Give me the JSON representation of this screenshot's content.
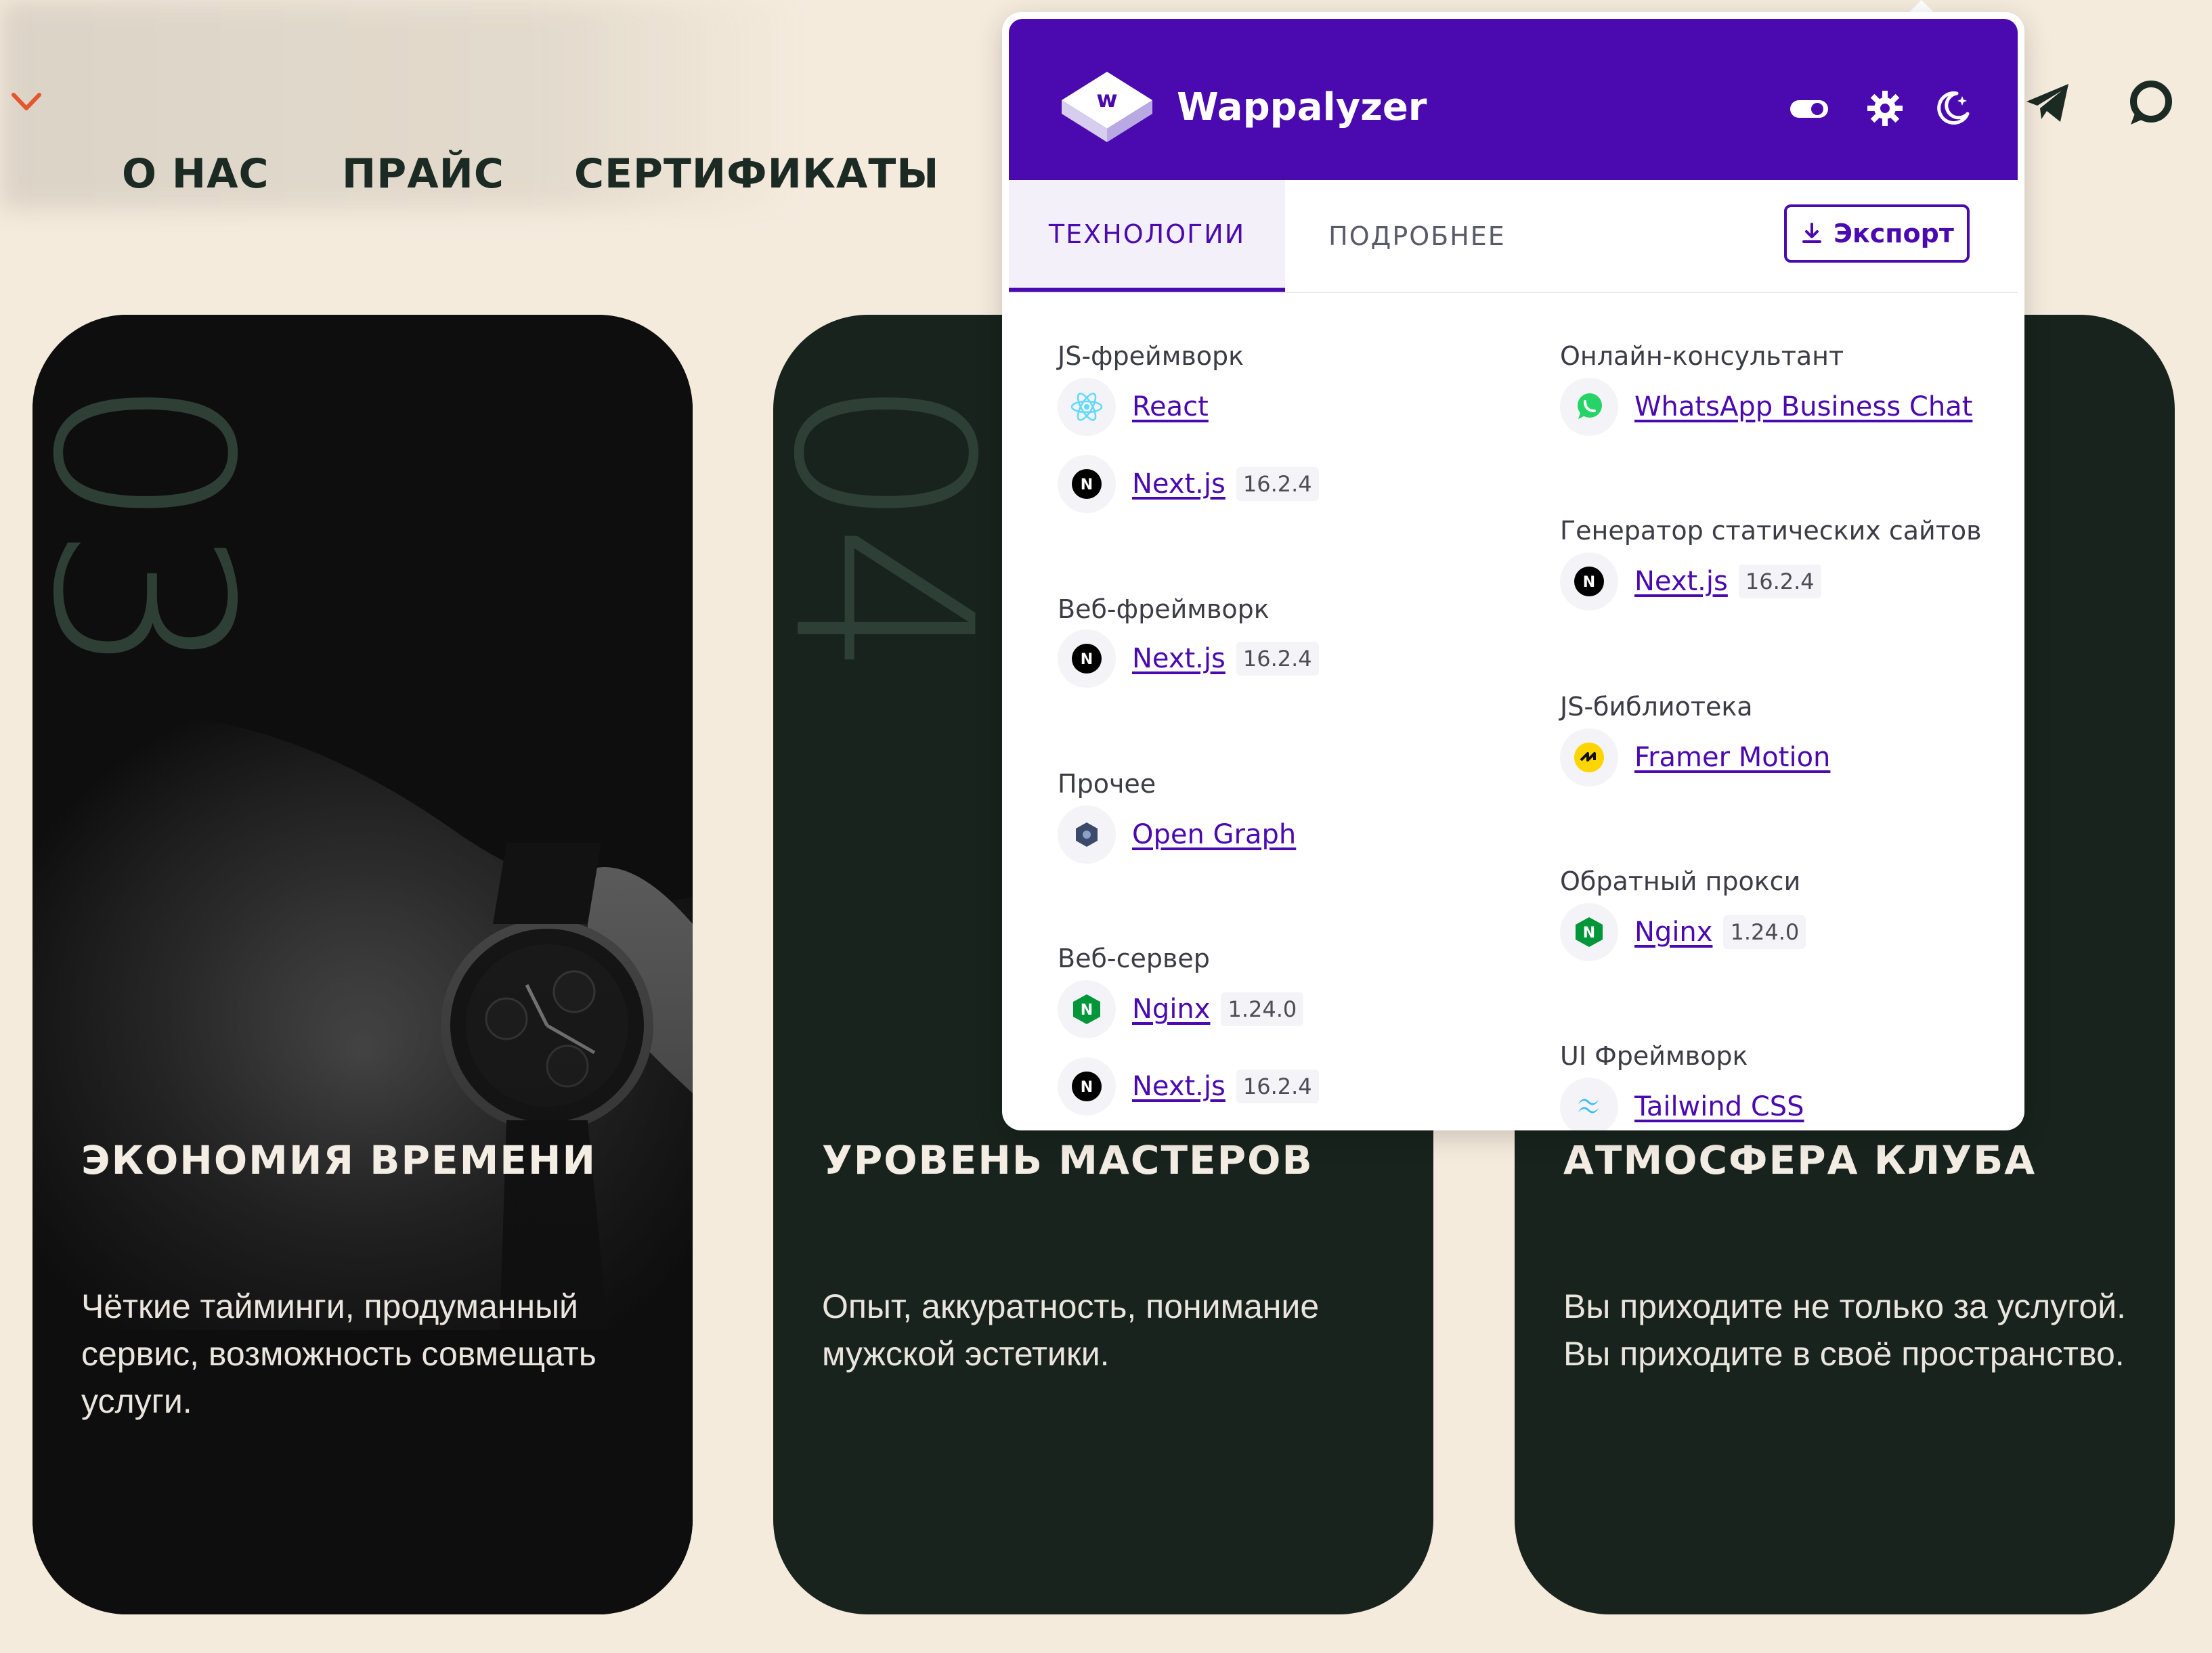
{
  "site": {
    "nav": {
      "about": "О НАС",
      "price": "ПРАЙС",
      "certificates": "СЕРТИФИКАТЫ"
    },
    "accent": "#e4572e"
  },
  "cards": [
    {
      "number": "03",
      "title": "ЭКОНОМИЯ ВРЕМЕНИ",
      "text": "Чёткие тайминги, продуманный сервис, возможность совмещать услуги."
    },
    {
      "number": "04",
      "title": "УРОВЕНЬ МАСТЕРОВ",
      "text": "Опыт, аккуратность, понимание мужской эстетики."
    },
    {
      "title": "АТМОСФЕРА КЛУБА",
      "text": "Вы приходите не только за услугой. Вы приходите в своё пространство."
    }
  ],
  "wappalyzer": {
    "brand": "Wappalyzer",
    "brand_color": "#4a0ab0",
    "tabs": {
      "technologies": "ТЕХНОЛОГИИ",
      "details": "ПОДРОБНЕЕ"
    },
    "export_label": "Экспорт",
    "left_column": [
      {
        "category": "JS-фреймворк",
        "items": [
          {
            "name": "React",
            "icon": "react-icon"
          },
          {
            "name": "Next.js",
            "version": "16.2.4",
            "icon": "nextjs-icon"
          }
        ]
      },
      {
        "category": "Веб-фреймворк",
        "items": [
          {
            "name": "Next.js",
            "version": "16.2.4",
            "icon": "nextjs-icon"
          }
        ]
      },
      {
        "category": "Прочее",
        "items": [
          {
            "name": "Open Graph",
            "icon": "open-graph-icon"
          }
        ]
      },
      {
        "category": "Веб-сервер",
        "items": [
          {
            "name": "Nginx",
            "version": "1.24.0",
            "icon": "nginx-icon"
          },
          {
            "name": "Next.js",
            "version": "16.2.4",
            "icon": "nextjs-icon"
          }
        ]
      }
    ],
    "right_column": [
      {
        "category": "Онлайн-консультант",
        "items": [
          {
            "name": "WhatsApp Business Chat",
            "icon": "whatsapp-icon"
          }
        ]
      },
      {
        "category": "Генератор статических сайтов",
        "items": [
          {
            "name": "Next.js",
            "version": "16.2.4",
            "icon": "nextjs-icon"
          }
        ]
      },
      {
        "category": "JS-библиотека",
        "items": [
          {
            "name": "Framer Motion",
            "icon": "framer-motion-icon"
          }
        ]
      },
      {
        "category": "Обратный прокси",
        "items": [
          {
            "name": "Nginx",
            "version": "1.24.0",
            "icon": "nginx-icon"
          }
        ]
      },
      {
        "category": "UI Фреймворк",
        "items": [
          {
            "name": "Tailwind CSS",
            "icon": "tailwind-icon"
          }
        ]
      }
    ]
  }
}
